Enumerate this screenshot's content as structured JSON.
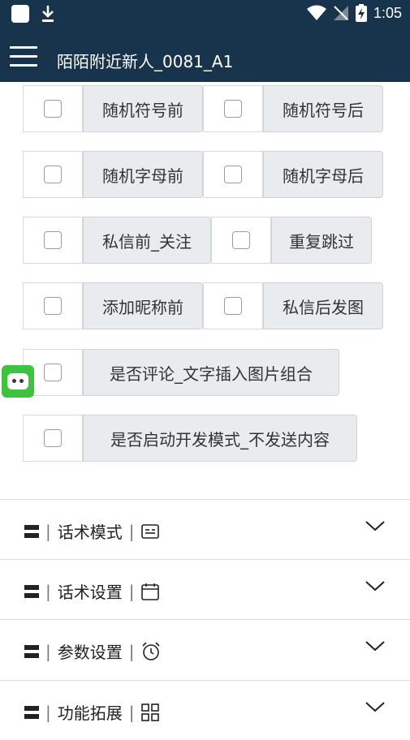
{
  "status": {
    "time": "1:05"
  },
  "app": {
    "title": "陌陌附近新人_0081_A1"
  },
  "rows": [
    {
      "left_label": "随机符号前",
      "right_label": "随机符号后"
    },
    {
      "left_label": "随机字母前",
      "right_label": "随机字母后"
    },
    {
      "left_label": "私信前_关注",
      "right_label": "重复跳过"
    },
    {
      "left_label": "添加昵称前",
      "right_label": "私信后发图"
    }
  ],
  "single_rows": [
    {
      "label": "是否评论_文字插入图片组合"
    },
    {
      "label": "是否启动开发模式_不发送内容"
    }
  ],
  "sections": [
    {
      "label": "话术模式",
      "icon": "id-card-icon"
    },
    {
      "label": "话术设置",
      "icon": "calendar-icon"
    },
    {
      "label": "参数设置",
      "icon": "alarm-clock-icon"
    },
    {
      "label": "功能拓展",
      "icon": "grid-icon"
    }
  ],
  "colors": {
    "header": "#17344c",
    "label_bg": "#e9ecef",
    "robot": "#3fc23f"
  }
}
